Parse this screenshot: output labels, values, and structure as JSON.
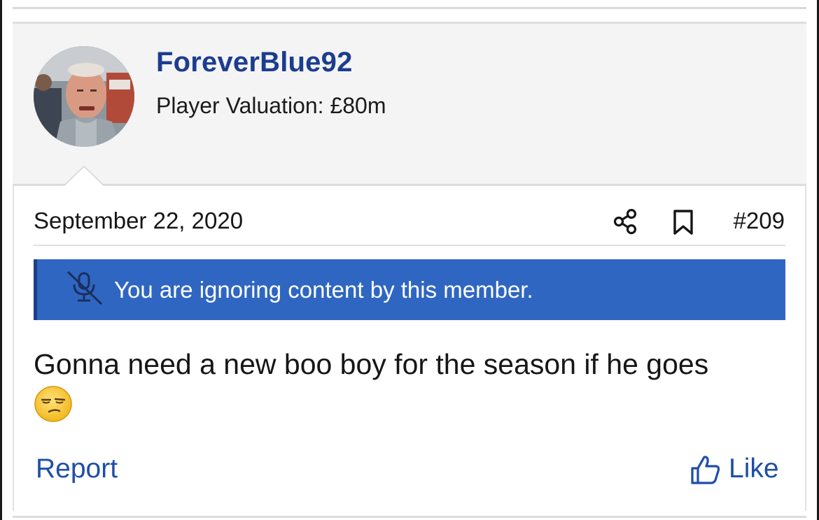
{
  "post": {
    "username": "ForeverBlue92",
    "user_title": "Player Valuation: £80m",
    "date": "September 22, 2020",
    "post_number": "#209",
    "ignored_notice": "You are ignoring content by this member.",
    "message": "Gonna need a new boo boy for the season if he goes",
    "emoji": "unamused-face-emoji",
    "report_label": "Report",
    "like_label": "Like"
  },
  "icons": {
    "share": "share-icon",
    "bookmark": "bookmark-icon",
    "ignored": "muted-microphone-icon",
    "like": "thumbs-up-icon"
  },
  "colors": {
    "username": "#1c3d8f",
    "link": "#1f4ea8",
    "notice_background": "#2f66c2",
    "notice_border": "#1d3f86",
    "header_background": "#f4f4f4"
  }
}
